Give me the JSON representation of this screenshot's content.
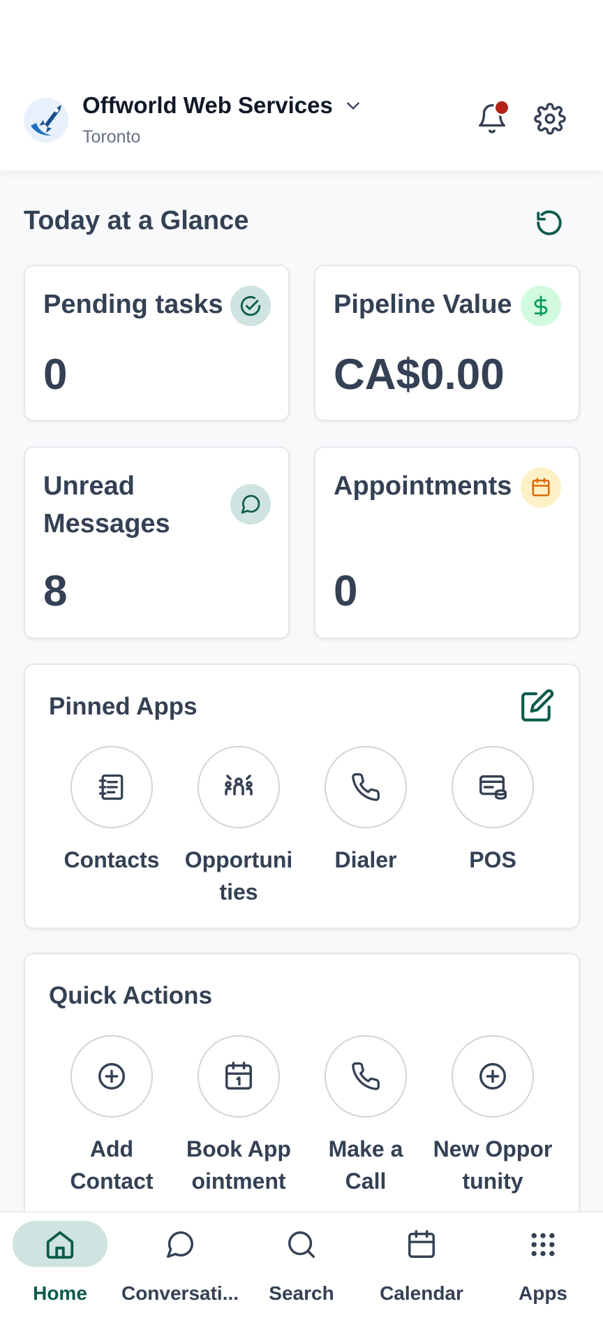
{
  "header": {
    "company_name": "Offworld Web Services",
    "location": "Toronto"
  },
  "glance": {
    "title": "Today at a Glance",
    "cards": [
      {
        "label": "Pending tasks",
        "value": "0",
        "icon": "check-circle-icon",
        "badge_color": "#cfe3e0"
      },
      {
        "label": "Pipeline Value",
        "value": "CA$0.00",
        "icon": "dollar-icon",
        "badge_color": "#d1fadf"
      },
      {
        "label": "Unread Messages",
        "value": "8",
        "icon": "chat-bubble-icon",
        "badge_color": "#cfe3e0"
      },
      {
        "label": "Appointments",
        "value": "0",
        "icon": "calendar-icon",
        "badge_color": "#fef0c7"
      }
    ]
  },
  "pinned_apps": {
    "title": "Pinned Apps",
    "items": [
      {
        "label": "Contacts",
        "icon": "contact-book-icon"
      },
      {
        "label": "Opportunities",
        "icon": "opportunities-icon"
      },
      {
        "label": "Dialer",
        "icon": "phone-icon"
      },
      {
        "label": "POS",
        "icon": "pos-icon"
      }
    ]
  },
  "quick_actions": {
    "title": "Quick Actions",
    "items": [
      {
        "label": "Add Contact",
        "icon": "plus-circle-icon"
      },
      {
        "label": "Book Appointment",
        "icon": "calendar-one-icon"
      },
      {
        "label": "Make a Call",
        "icon": "phone-icon"
      },
      {
        "label": "New Opportunity",
        "icon": "plus-circle-icon"
      }
    ]
  },
  "bottom_nav": {
    "items": [
      {
        "label": "Home",
        "icon": "home-icon",
        "active": true
      },
      {
        "label": "Conversati...",
        "icon": "chat-icon"
      },
      {
        "label": "Search",
        "icon": "search-icon"
      },
      {
        "label": "Calendar",
        "icon": "calendar-icon"
      },
      {
        "label": "Apps",
        "icon": "grid-icon"
      }
    ]
  },
  "colors": {
    "accent": "#0b5b4b",
    "active_pill": "#cfe3e0",
    "notification": "#b42318"
  }
}
